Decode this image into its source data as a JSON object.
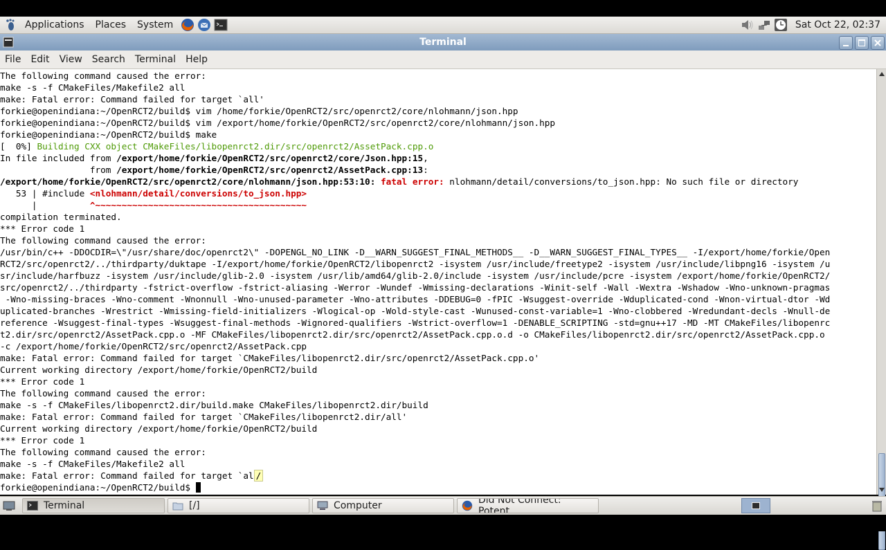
{
  "top_panel": {
    "menus": [
      "Applications",
      "Places",
      "System"
    ],
    "clock": "Sat Oct 22, 02:37"
  },
  "window": {
    "title": "Terminal"
  },
  "menubar": [
    "File",
    "Edit",
    "View",
    "Search",
    "Terminal",
    "Help"
  ],
  "terminal": {
    "lines": [
      [
        {
          "t": "The following command caused the error:"
        }
      ],
      [
        {
          "t": "make -s -f CMakeFiles/Makefile2 all"
        }
      ],
      [
        {
          "t": "make: Fatal error: Command failed for target `all'"
        }
      ],
      [
        {
          "t": "forkie@openindiana:~/OpenRCT2/build$ vim /home/forkie/OpenRCT2/src/openrct2/core/nlohmann/json.hpp"
        }
      ],
      [
        {
          "t": "forkie@openindiana:~/OpenRCT2/build$ vim /export/home/forkie/OpenRCT2/src/openrct2/core/nlohmann/json.hpp"
        }
      ],
      [
        {
          "t": "forkie@openindiana:~/OpenRCT2/build$ make"
        }
      ],
      [
        {
          "t": "[  0%] "
        },
        {
          "t": "Building CXX object CMakeFiles/libopenrct2.dir/src/openrct2/AssetPack.cpp.o",
          "c": "g"
        }
      ],
      [
        {
          "t": "In file included from "
        },
        {
          "t": "/export/home/forkie/OpenRCT2/src/openrct2/core/Json.hpp:15",
          "c": "b"
        },
        {
          "t": ","
        }
      ],
      [
        {
          "t": "                 from "
        },
        {
          "t": "/export/home/forkie/OpenRCT2/src/openrct2/AssetPack.cpp:13",
          "c": "b"
        },
        {
          "t": ":"
        }
      ],
      [
        {
          "t": "/export/home/forkie/OpenRCT2/src/openrct2/core/nlohmann/json.hpp:53:10:",
          "c": "b"
        },
        {
          "t": " "
        },
        {
          "t": "fatal error:",
          "c": "r"
        },
        {
          "t": " nlohmann/detail/conversions/to_json.hpp: No such file or directory"
        }
      ],
      [
        {
          "t": "   53 | #include "
        },
        {
          "t": "<nlohmann/detail/conversions/to_json.hpp>",
          "c": "r"
        }
      ],
      [
        {
          "t": "      |          "
        },
        {
          "t": "^~~~~~~~~~~~~~~~~~~~~~~~~~~~~~~~~~~~~~~~~",
          "c": "r"
        }
      ],
      [
        {
          "t": "compilation terminated."
        }
      ],
      [
        {
          "t": "*** Error code 1"
        }
      ],
      [
        {
          "t": "The following command caused the error:"
        }
      ],
      [
        {
          "t": "/usr/bin/c++ -DDOCDIR=\\\"/usr/share/doc/openrct2\\\" -DOPENGL_NO_LINK -D__WARN_SUGGEST_FINAL_METHODS__ -D__WARN_SUGGEST_FINAL_TYPES__ -I/export/home/forkie/Open"
        }
      ],
      [
        {
          "t": "RCT2/src/openrct2/../thirdparty/duktape -I/export/home/forkie/OpenRCT2/libopenrct2 -isystem /usr/include/freetype2 -isystem /usr/include/libpng16 -isystem /u"
        }
      ],
      [
        {
          "t": "sr/include/harfbuzz -isystem /usr/include/glib-2.0 -isystem /usr/lib/amd64/glib-2.0/include -isystem /usr/include/pcre -isystem /export/home/forkie/OpenRCT2/"
        }
      ],
      [
        {
          "t": "src/openrct2/../thirdparty -fstrict-overflow -fstrict-aliasing -Werror -Wundef -Wmissing-declarations -Winit-self -Wall -Wextra -Wshadow -Wno-unknown-pragmas"
        }
      ],
      [
        {
          "t": " -Wno-missing-braces -Wno-comment -Wnonnull -Wno-unused-parameter -Wno-attributes -DDEBUG=0 -fPIC -Wsuggest-override -Wduplicated-cond -Wnon-virtual-dtor -Wd"
        }
      ],
      [
        {
          "t": "uplicated-branches -Wrestrict -Wmissing-field-initializers -Wlogical-op -Wold-style-cast -Wunused-const-variable=1 -Wno-clobbered -Wredundant-decls -Wnull-de"
        }
      ],
      [
        {
          "t": "reference -Wsuggest-final-types -Wsuggest-final-methods -Wignored-qualifiers -Wstrict-overflow=1 -DENABLE_SCRIPTING -std=gnu++17 -MD -MT CMakeFiles/libopenrc"
        }
      ],
      [
        {
          "t": "t2.dir/src/openrct2/AssetPack.cpp.o -MF CMakeFiles/libopenrct2.dir/src/openrct2/AssetPack.cpp.o.d -o CMakeFiles/libopenrct2.dir/src/openrct2/AssetPack.cpp.o"
        }
      ],
      [
        {
          "t": "-c /export/home/forkie/OpenRCT2/src/openrct2/AssetPack.cpp"
        }
      ],
      [
        {
          "t": "make: Fatal error: Command failed for target `CMakeFiles/libopenrct2.dir/src/openrct2/AssetPack.cpp.o'"
        }
      ],
      [
        {
          "t": "Current working directory /export/home/forkie/OpenRCT2/build"
        }
      ],
      [
        {
          "t": "*** Error code 1"
        }
      ],
      [
        {
          "t": "The following command caused the error:"
        }
      ],
      [
        {
          "t": "make -s -f CMakeFiles/libopenrct2.dir/build.make CMakeFiles/libopenrct2.dir/build"
        }
      ],
      [
        {
          "t": "make: Fatal error: Command failed for target `CMakeFiles/libopenrct2.dir/all'"
        }
      ],
      [
        {
          "t": "Current working directory /export/home/forkie/OpenRCT2/build"
        }
      ],
      [
        {
          "t": "*** Error code 1"
        }
      ],
      [
        {
          "t": "The following command caused the error:"
        }
      ],
      [
        {
          "t": "make -s -f CMakeFiles/Makefile2 all"
        }
      ],
      [
        {
          "t": "make: Fatal error: Command failed for target `al"
        },
        {
          "t": "/",
          "c": "tooltip"
        }
      ],
      [
        {
          "t": "forkie@openindiana:~/OpenRCT2/build$ "
        },
        {
          "t": " ",
          "c": "cursor"
        }
      ]
    ]
  },
  "taskbar": {
    "tasks": [
      "Terminal",
      "[/]",
      "Computer",
      "Did Not Connect: Potent..."
    ]
  },
  "colors": {
    "titlebar": "#8fa9c7",
    "build_green": "#4e9a06",
    "error_red": "#cc0000"
  }
}
